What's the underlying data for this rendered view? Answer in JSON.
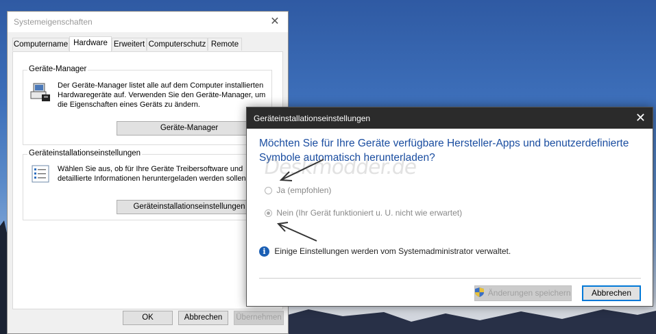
{
  "window1": {
    "title": "Systemeigenschaften",
    "tabs": [
      {
        "label": "Computername"
      },
      {
        "label": "Hardware"
      },
      {
        "label": "Erweitert"
      },
      {
        "label": "Computerschutz"
      },
      {
        "label": "Remote"
      }
    ],
    "active_tab": "Hardware",
    "device_manager": {
      "group_label": "Geräte-Manager",
      "text_line1": "Der Geräte-Manager listet alle auf dem Computer installierten",
      "text_line2": "Hardwaregeräte auf. Verwenden Sie den Geräte-Manager, um",
      "text_line3": "die Eigenschaften eines Geräts zu ändern.",
      "button_label": "Geräte-Manager"
    },
    "device_install": {
      "group_label": "Geräteinstallationseinstellungen",
      "text_line1": "Wählen Sie aus, ob für Ihre Geräte Treibersoftware und",
      "text_line2": "detaillierte Informationen heruntergeladen werden sollen.",
      "button_label": "Geräteinstallationseinstellungen"
    },
    "footer": {
      "ok_label": "OK",
      "cancel_label": "Abbrechen",
      "apply_label": "Übernehmen"
    }
  },
  "window2": {
    "title": "Geräteinstallationseinstellungen",
    "question_line1": "Möchten Sie für Ihre Geräte verfügbare Hersteller-Apps und benutzerdefinierte",
    "question_line2": "Symbole automatisch herunterladen?",
    "options": [
      {
        "label": "Ja (empfohlen)",
        "checked": false
      },
      {
        "label": "Nein (Ihr Gerät funktioniert u. U. nicht wie erwartet)",
        "checked": true
      }
    ],
    "info_text": "Einige Einstellungen werden vom Systemadministrator verwaltet.",
    "save_label": "Änderungen speichern",
    "cancel_label": "Abbrechen"
  },
  "watermark": "Deskmodder.de",
  "colors": {
    "question_blue": "#1a4da0",
    "dark_titlebar": "#2b2b2b",
    "info_blue": "#1a5fb4",
    "focus_border": "#0078d7"
  }
}
